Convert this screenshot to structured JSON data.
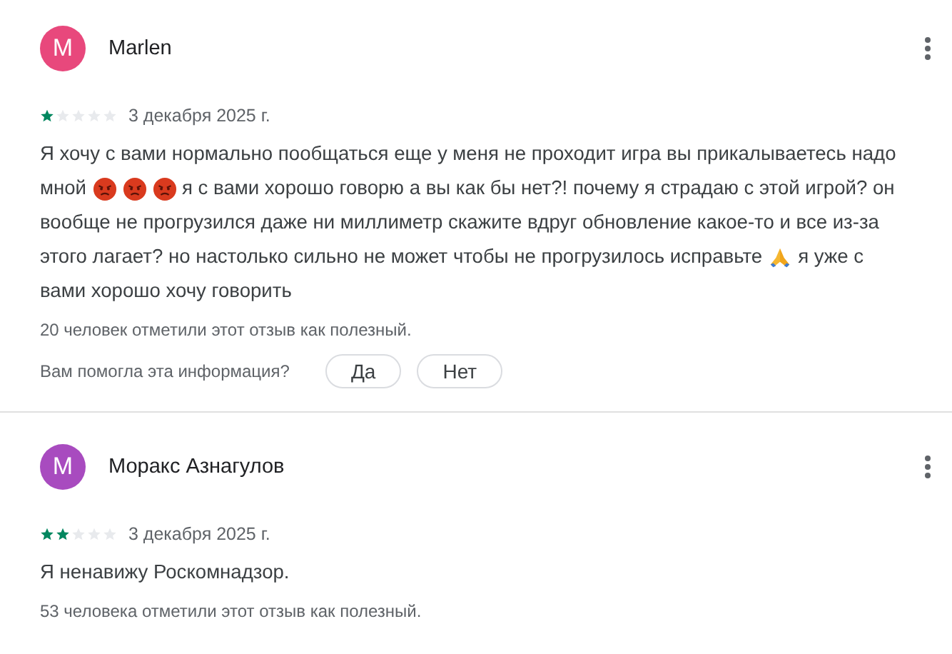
{
  "reviews": [
    {
      "author": "Marlen",
      "avatar_letter": "M",
      "color": "#e8487c",
      "stars": 1,
      "date": "3 декабря 2025 г.",
      "body": [
        [
          {
            "kind": "text",
            "text": "Я хочу с вами нормально пообщаться еще у меня не проходит игра вы прикалываетесь надо"
          }
        ],
        [
          {
            "kind": "text",
            "text": "мной"
          },
          {
            "kind": "angry"
          },
          {
            "kind": "angry"
          },
          {
            "kind": "angry"
          },
          {
            "kind": "text",
            "text": "я с вами хорошо говорю а вы как бы нет?! почему я страдаю с этой игрой? он"
          }
        ],
        [
          {
            "kind": "text",
            "text": "вообще не прогрузился даже ни миллиметр скажите вдруг обновление какое-то и все из-за"
          }
        ],
        [
          {
            "kind": "text",
            "text": "этого лагает? но настолько сильно не может чтобы не прогрузилось исправьте"
          },
          {
            "kind": "pray"
          },
          {
            "kind": "text",
            "text": "я уже с"
          }
        ],
        [
          {
            "kind": "text",
            "text": "вами хорошо хочу говорить"
          }
        ]
      ],
      "helpful": "20 человек отметили этот отзыв как полезный.",
      "question": "Вам помогла эта информация?",
      "buttons": [
        "Да",
        "Нет"
      ]
    },
    {
      "author": "Моракс Азнагулов",
      "avatar_letter": "M",
      "color": "#a84bbf",
      "stars": 2,
      "date": "3 декабря 2025 г.",
      "body": [
        [
          {
            "kind": "text",
            "text": "Я ненавижу Роскомнадзор."
          }
        ]
      ],
      "helpful": "53 человека отметили этот отзыв как полезный."
    }
  ]
}
